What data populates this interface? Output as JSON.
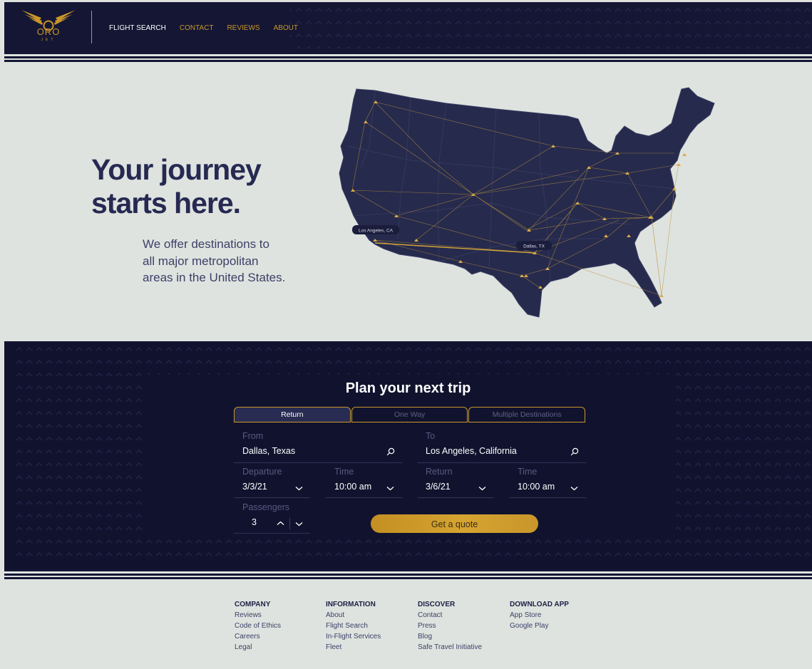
{
  "brand": {
    "name": "ORO",
    "sub": "JET",
    "gold": "#c9962a",
    "navy": "#141634"
  },
  "nav": [
    {
      "label": "FLIGHT SEARCH",
      "active": true
    },
    {
      "label": "CONTACT",
      "active": false
    },
    {
      "label": "REVIEWS",
      "active": false
    },
    {
      "label": "ABOUT",
      "active": false
    }
  ],
  "hero": {
    "title_line1": "Your journey",
    "title_line2": "starts here.",
    "subtitle_line1": "We offer destinations to",
    "subtitle_line2": "all major metropolitan",
    "subtitle_line3": "areas in the United States.",
    "map_labels": {
      "origin": "Los Angeles, CA",
      "destination": "Dallas, TX"
    }
  },
  "planner": {
    "title": "Plan your next trip",
    "tabs": [
      "Return",
      "One Way",
      "Multiple Destinations"
    ],
    "from_label": "From",
    "from_value": "Dallas, Texas",
    "to_label": "To",
    "to_value": "Los Angeles, California",
    "departure_label": "Departure",
    "departure_value": "3/3/21",
    "dep_time_label": "Time",
    "dep_time_value": "10:00 am",
    "return_label": "Return",
    "return_value": "3/6/21",
    "ret_time_label": "Time",
    "ret_time_value": "10:00 am",
    "passengers_label": "Passengers",
    "passengers_value": "3",
    "quote_label": "Get a quote"
  },
  "footer": {
    "company": {
      "title": "COMPANY",
      "links": [
        "Reviews",
        "Code of Ethics",
        "Careers",
        "Legal"
      ]
    },
    "information": {
      "title": "INFORMATION",
      "links": [
        "About",
        "Flight Search",
        "In-Flight Services",
        "Fleet"
      ]
    },
    "discover": {
      "title": "DISCOVER",
      "links": [
        "Contact",
        "Press",
        "Blog",
        "Safe Travel Initiative"
      ]
    },
    "download": {
      "title": "DOWNLOAD APP",
      "links": [
        "App Store",
        "Google Play"
      ]
    }
  },
  "icons": {
    "search": "search-icon",
    "chevron": "chevron-down-icon",
    "up": "chevron-up-icon"
  }
}
